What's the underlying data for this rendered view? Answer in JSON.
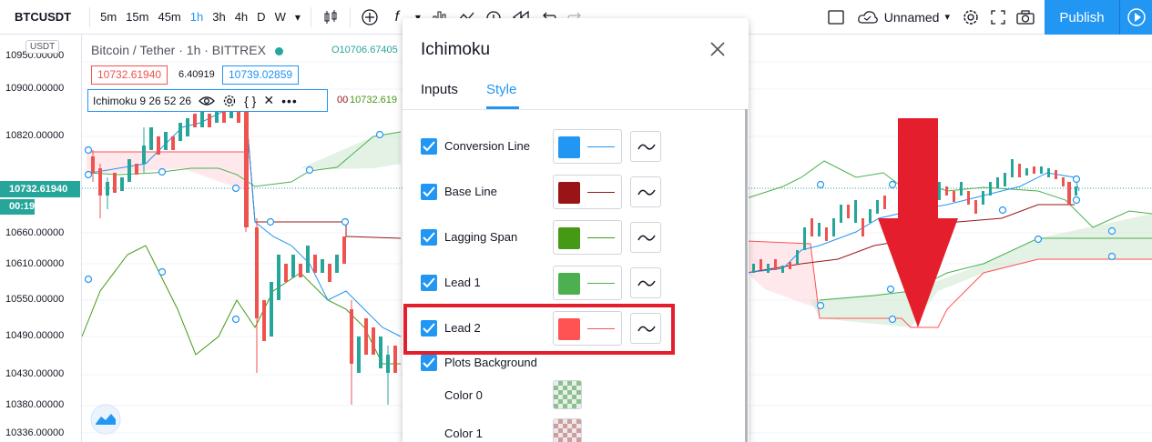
{
  "toolbar": {
    "symbol": "BTCUSDT",
    "timeframes": [
      "5m",
      "15m",
      "45m",
      "1h",
      "3h",
      "4h",
      "D",
      "W"
    ],
    "active_timeframe": "1h",
    "layout_name": "Unnamed",
    "publish_label": "Publish"
  },
  "chart": {
    "currency_label": "USDT",
    "title": "Bitcoin / Tether · 1h · BITTREX",
    "ohlc_open": "O10706.67405",
    "bid_price": "10732.61940",
    "spread": "6.40919",
    "ask_price": "10739.02859",
    "indicator_label": "Ichimoku 9 26 52 26",
    "indicator_value_red": "00",
    "indicator_value_green": "10732.619",
    "price_ticks": [
      "10950.00000",
      "10900.00000",
      "10820.00000",
      "10732.61940",
      "10660.00000",
      "10610.00000",
      "10550.00000",
      "10490.00000",
      "10430.00000",
      "10380.00000",
      "10336.00000"
    ],
    "current_price": "10732.61940",
    "countdown": "00:19"
  },
  "dialog": {
    "title": "Ichimoku",
    "tabs": [
      "Inputs",
      "Style"
    ],
    "active_tab": "Style",
    "rows": [
      {
        "label": "Conversion Line",
        "checked": true,
        "color": "#2196f3"
      },
      {
        "label": "Base Line",
        "checked": true,
        "color": "#991515"
      },
      {
        "label": "Lagging Span",
        "checked": true,
        "color": "#459915"
      },
      {
        "label": "Lead 1",
        "checked": true,
        "color": "#4caf50"
      },
      {
        "label": "Lead 2",
        "checked": true,
        "color": "#ff5252"
      }
    ],
    "plots_background": {
      "label": "Plots Background",
      "checked": true
    },
    "background_colors": [
      {
        "label": "Color 0",
        "color": "#4caf50"
      },
      {
        "label": "Color 1",
        "color": "#ff5252"
      }
    ]
  },
  "annotation": {
    "highlight_color": "#e41e2d",
    "highlighted_row": "Lead 2"
  }
}
